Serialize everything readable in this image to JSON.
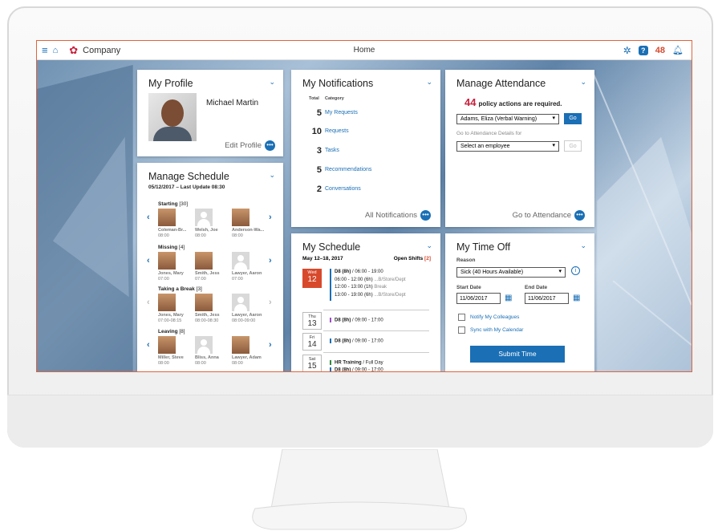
{
  "header": {
    "company": "Company",
    "title": "Home",
    "alert_count": "48"
  },
  "profile": {
    "title": "My Profile",
    "name": "Michael Martin",
    "edit_label": "Edit Profile"
  },
  "schedule_mgr": {
    "title": "Manage Schedule",
    "date": "05/12/2017",
    "update": "– Last Update 08:30",
    "groups": [
      {
        "label": "Starting",
        "count": "[30]",
        "people": [
          [
            "Coleman-Br...",
            "08:00"
          ],
          [
            "Welsh, Joe",
            "08:00"
          ],
          [
            "Anderson-Wa...",
            "08:00"
          ]
        ]
      },
      {
        "label": "Missing",
        "count": "[4]",
        "people": [
          [
            "Jones, Mary",
            "07:00"
          ],
          [
            "Smith, Jess",
            "07:00"
          ],
          [
            "Lawyer, Aaron",
            "07:00"
          ]
        ]
      },
      {
        "label": "Taking a Break",
        "count": "[3]",
        "people": [
          [
            "Jones, Mary",
            "07:00-08:15"
          ],
          [
            "Smith, Jess",
            "08:00-08:30"
          ],
          [
            "Lawyer, Aaron",
            "08:00-09:00"
          ]
        ]
      },
      {
        "label": "Leaving",
        "count": "[8]",
        "people": [
          [
            "Miller, Steve",
            "08:00"
          ],
          [
            "Bliss, Anna",
            "08:00"
          ],
          [
            "Lawyer, Adam",
            "08:00"
          ]
        ]
      }
    ]
  },
  "notifications": {
    "title": "My Notifications",
    "col_total": "Total",
    "col_category": "Category",
    "items": [
      [
        "5",
        "My Requests"
      ],
      [
        "10",
        "Requests"
      ],
      [
        "3",
        "Tasks"
      ],
      [
        "5",
        "Recommendations"
      ],
      [
        "2",
        "Conversations"
      ]
    ],
    "all_label": "All Notifications"
  },
  "attendance": {
    "title": "Manage Attendance",
    "count": "44",
    "count_text": "policy actions are required.",
    "employee": "Adams, Eliza (Verbal Warning)",
    "go": "Go",
    "details_label": "Go to Attendance Details for",
    "select_placeholder": "Select an employee",
    "go2": "Go",
    "footer": "Go to Attendance"
  },
  "myschedule": {
    "title": "My Schedule",
    "range": "May 12–18, 2017",
    "open_shifts": "Open Shifts",
    "open_count": "[2]",
    "days": [
      {
        "dow": "Wed",
        "day": "12",
        "lines": [
          [
            "D8 (8h)",
            "/ 06:00 - 19:00",
            ""
          ],
          [
            "06:00 - 12:00 (6h)",
            "...B/Store/Dept",
            ""
          ],
          [
            "12:00 - 13:00 (1h)",
            "Break",
            ""
          ],
          [
            "13:00 - 19:00 (6h)",
            "...B/Store/Dept",
            ""
          ]
        ]
      },
      {
        "dow": "Thu",
        "day": "13",
        "lines": [
          [
            "D8 (8h)",
            "/ 09:00 - 17:00",
            "#9b4fc4"
          ]
        ]
      },
      {
        "dow": "Fri",
        "day": "14",
        "lines": [
          [
            "D8 (8h)",
            "/ 09:00 - 17:00",
            "#1a6fb5"
          ]
        ]
      },
      {
        "dow": "Sat",
        "day": "15",
        "lines": [
          [
            "HR Training",
            "/ Full Day",
            "#2e8b3c"
          ],
          [
            "D8 (8h)",
            "/ 09:00 - 17:00",
            "#1a6fb5"
          ]
        ]
      }
    ]
  },
  "timeoff": {
    "title": "My Time Off",
    "reason_label": "Reason",
    "reason": "Sick (40 Hours Available)",
    "start_label": "Start Date",
    "end_label": "End Date",
    "start": "11/06/2017",
    "end": "11/06/2017",
    "notify": "Notify My Colleagues",
    "sync": "Sync with My Calendar",
    "submit": "Submit Time"
  },
  "colors": {
    "accent": "#1a6fb5",
    "alert": "#d8492c",
    "today": "#d8492c"
  }
}
